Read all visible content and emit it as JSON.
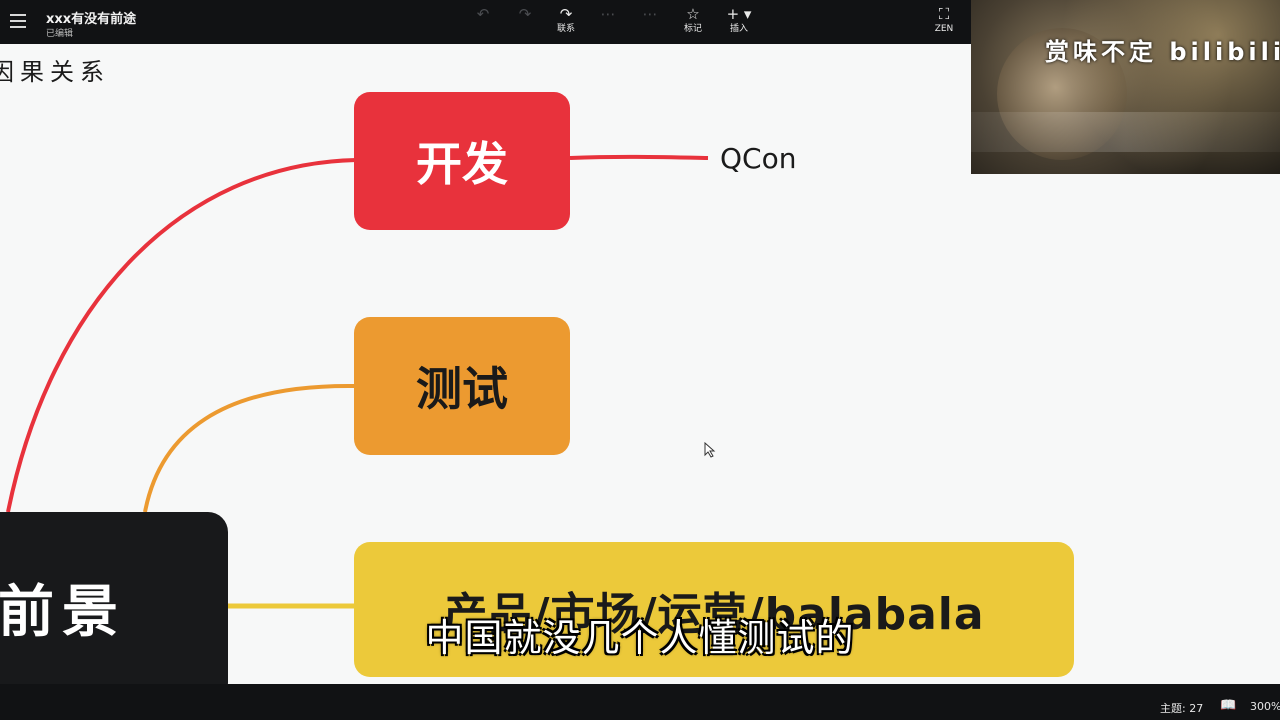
{
  "header": {
    "title": "xxx有没有前途",
    "status": "已编辑",
    "tools": [
      {
        "label": "",
        "icon": "undo-icon"
      },
      {
        "label": "",
        "icon": "redo-icon"
      },
      {
        "label": "联系",
        "icon": "link-icon"
      },
      {
        "label": "",
        "icon": "format-icon"
      },
      {
        "label": "",
        "icon": "style-icon"
      },
      {
        "label": "标记",
        "icon": "star-icon"
      },
      {
        "label": "插入",
        "icon": "plus-icon"
      },
      {
        "label": "ZEN",
        "icon": "fullscreen-icon"
      }
    ]
  },
  "canvas": {
    "section_label": "因果关系",
    "nodes": {
      "dev": "开发",
      "test": "测试",
      "prod": "产品/市场/运营/balabala",
      "root": "前景"
    },
    "leaf": "QCon",
    "colors": {
      "dev": "#e8323c",
      "test": "#ec9a30",
      "prod": "#ecc93a",
      "root": "#18191b"
    }
  },
  "video_overlay": {
    "camera_text": "赏味不定 bilibili",
    "subtitle": "中国就没几个人懂测试的"
  },
  "status_bar": {
    "word_count": "主题: 27",
    "zoom": "300%"
  }
}
